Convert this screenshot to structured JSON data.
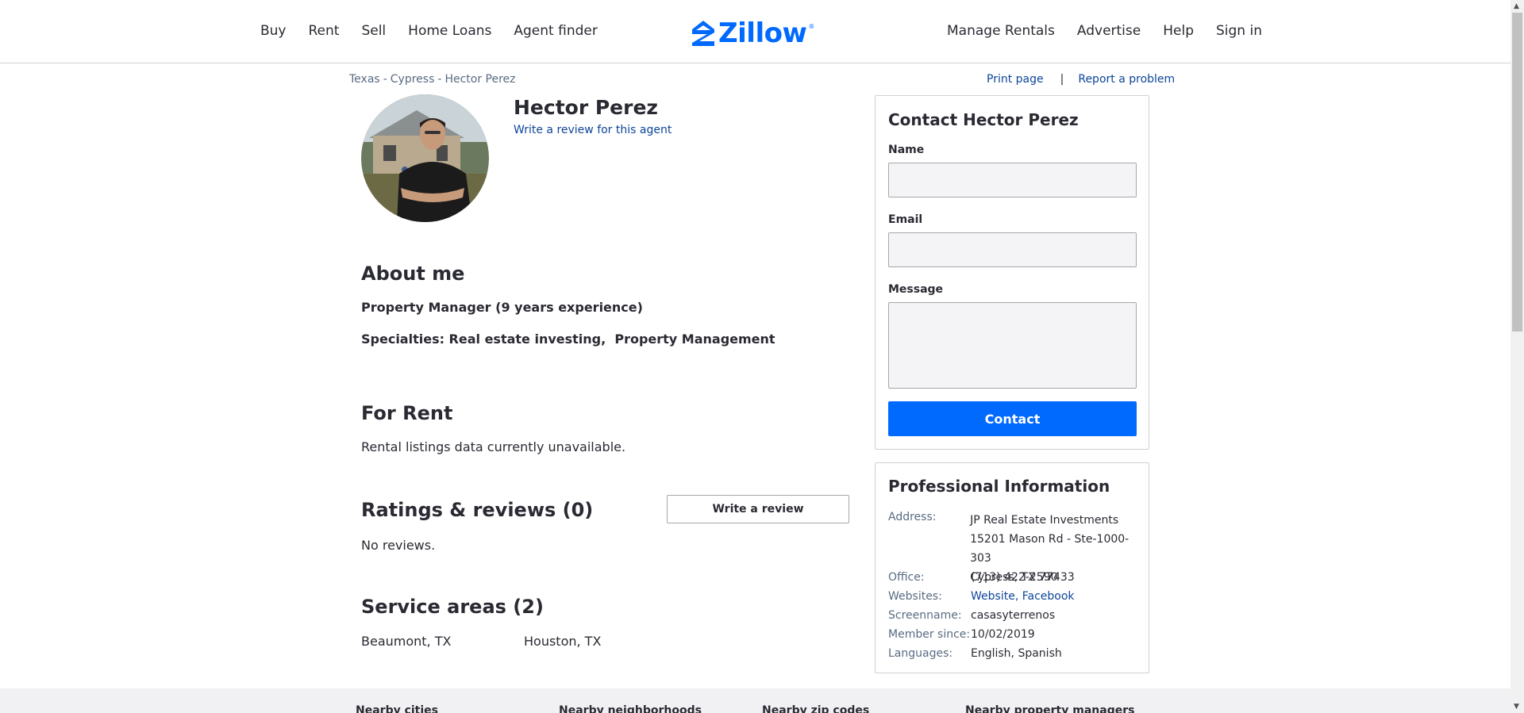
{
  "header": {
    "nav_left": [
      "Buy",
      "Rent",
      "Sell",
      "Home Loans",
      "Agent finder"
    ],
    "logo_text": "Zillow",
    "logo_mark": "®",
    "nav_right": [
      "Manage Rentals",
      "Advertise",
      "Help",
      "Sign in"
    ],
    "brand_color": "#006aff"
  },
  "breadcrumb": {
    "state": "Texas",
    "city": "Cypress",
    "agent": "Hector Perez",
    "separator": "-"
  },
  "top_links": {
    "print": "Print page",
    "separator": "|",
    "report": "Report a problem"
  },
  "profile": {
    "name": "Hector Perez",
    "review_link": "Write a review for this agent",
    "photo": "agent-photo"
  },
  "about": {
    "heading": "About me",
    "title_line": "Property Manager (9 years experience)",
    "specialties": "Specialties: Real estate investing,  Property Management"
  },
  "for_rent": {
    "heading": "For Rent",
    "status": "Rental listings data currently unavailable."
  },
  "ratings": {
    "heading": "Ratings & reviews (0)",
    "button": "Write a review",
    "empty": "No reviews."
  },
  "service_areas": {
    "heading": "Service areas (2)",
    "areas": [
      "Beaumont, TX",
      "Houston, TX"
    ]
  },
  "contact": {
    "heading": "Contact Hector Perez",
    "name_label": "Name",
    "name_value": "",
    "email_label": "Email",
    "email_value": "",
    "message_label": "Message",
    "message_value": "",
    "button": "Contact"
  },
  "pro_info": {
    "heading": "Professional Information",
    "address_label": "Address:",
    "address_lines": [
      "JP Real Estate Investments",
      "15201 Mason Rd - Ste-1000-303",
      "Cypress, TX 77433"
    ],
    "office_label": "Office:",
    "office": "(713) 422-2590",
    "websites_label": "Websites:",
    "website_link": "Website",
    "websites_sep": ", ",
    "facebook_link": "Facebook",
    "screenname_label": "Screenname:",
    "screenname": "casasyterrenos",
    "member_label": "Member since:",
    "member_since": "10/02/2019",
    "languages_label": "Languages:",
    "languages": "English, Spanish"
  },
  "footer": {
    "columns": [
      "Nearby cities",
      "Nearby neighborhoods",
      "Nearby zip codes",
      "Nearby property managers"
    ]
  },
  "scrollbar": {
    "up_icon": "▲",
    "down_icon": "▼"
  }
}
